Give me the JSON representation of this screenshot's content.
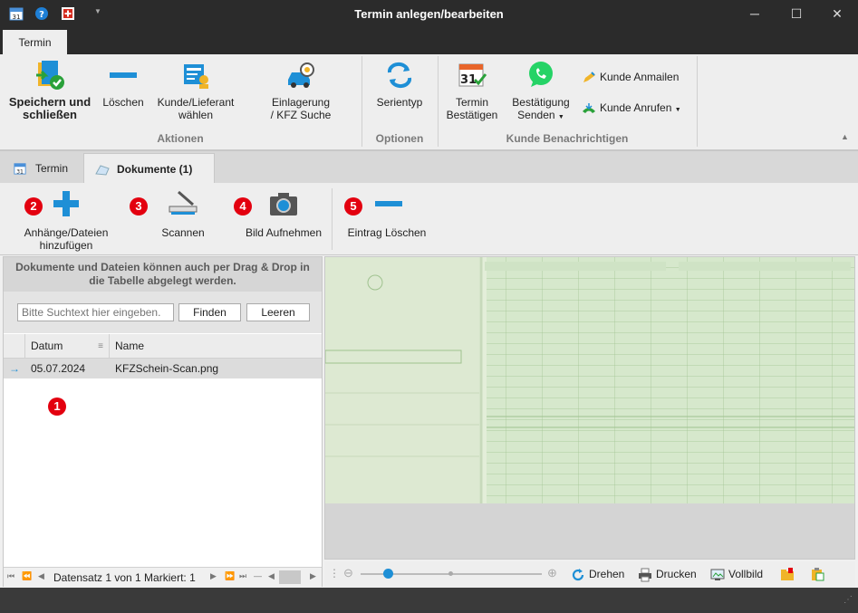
{
  "window": {
    "title": "Termin anlegen/bearbeiten",
    "controls": {
      "minimize": "─",
      "maximize": "☐",
      "close": "✕"
    },
    "quick_access": [
      "calendar-icon",
      "help-icon",
      "swiss-flag-icon",
      "dropdown-icon"
    ]
  },
  "ribbon": {
    "tab": "Termin",
    "groups": {
      "aktionen": {
        "label": "Aktionen",
        "save_line1": "Speichern und",
        "save_line2": "schließen",
        "delete": "Löschen",
        "customer_line1": "Kunde/Lieferant",
        "customer_line2": "wählen",
        "storage_line1": "Einlagerung",
        "storage_line2": "/ KFZ Suche"
      },
      "optionen": {
        "label": "Optionen",
        "series": "Serientyp"
      },
      "benachrichtigen": {
        "label": "Kunde Benachrichtigen",
        "confirm_line1": "Termin",
        "confirm_line2": "Bestätigen",
        "send_line1": "Bestätigung",
        "send_line2": "Senden",
        "email": "Kunde Anmailen",
        "call": "Kunde Anrufen"
      }
    }
  },
  "doc_tabs": [
    {
      "label": "Termin"
    },
    {
      "label": "Dokumente (1)"
    }
  ],
  "toolbar": {
    "add_line1": "Anhänge/Dateien",
    "add_line2": "hinzufügen",
    "scan": "Scannen",
    "photo": "Bild Aufnehmen",
    "delete_entry": "Eintrag Löschen",
    "badges": [
      "2",
      "3",
      "4",
      "5"
    ]
  },
  "left_panel": {
    "hint_line1": "Dokumente und Dateien können auch per Drag & Drop in",
    "hint_line2": "die Tabelle abgelegt werden.",
    "search_placeholder": "Bitte Suchtext hier eingeben.",
    "find_button": "Finden",
    "clear_button": "Leeren",
    "columns": {
      "date": "Datum",
      "name": "Name"
    },
    "rows": [
      {
        "date": "05.07.2024",
        "name": "KFZSchein-Scan.png"
      }
    ],
    "badge": "1",
    "footer": "Datensatz 1 von 1 Markiert: 1"
  },
  "preview": {
    "zoom": 0.15,
    "rotate": "Drehen",
    "print": "Drucken",
    "fullscreen": "Vollbild"
  },
  "colors": {
    "titlebar": "#2b2b2b",
    "accent_blue": "#1e8fd6",
    "badge_red": "#e3000f",
    "doc_green": "#cfe3c5"
  }
}
